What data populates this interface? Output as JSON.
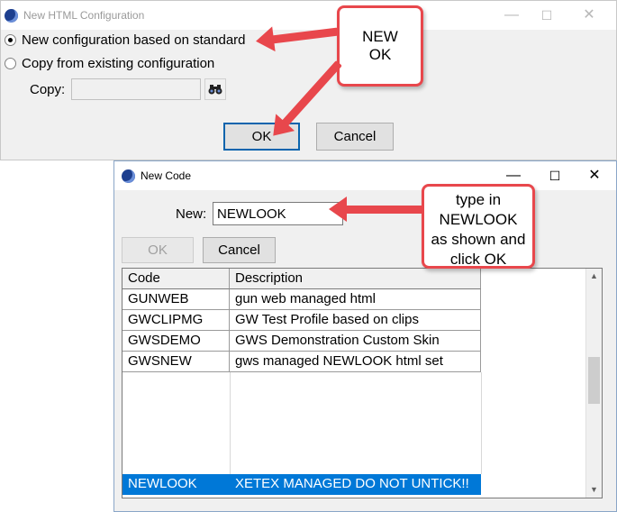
{
  "dialog1": {
    "title": "New HTML Configuration",
    "controls": {
      "minimize": "—",
      "maximize": "☐",
      "close": "✕"
    },
    "option_standard": "New configuration based on standard",
    "option_copy": "Copy from existing configuration",
    "copy_label": "Copy:",
    "copy_value": "",
    "ok_label": "OK",
    "cancel_label": "Cancel"
  },
  "dialog2": {
    "title": "New Code",
    "controls": {
      "minimize": "—",
      "maximize": "☐",
      "close": "✕"
    },
    "new_label": "New:",
    "new_value": "NEWLOOK",
    "ok_label": "OK",
    "cancel_label": "Cancel",
    "columns": [
      "Code",
      "Description"
    ],
    "rows": [
      {
        "code": "GUNWEB",
        "description": "gun web managed html"
      },
      {
        "code": "GWCLIPMG",
        "description": "GW Test Profile based on clips"
      },
      {
        "code": "GWSDEMO",
        "description": "GWS Demonstration Custom Skin"
      },
      {
        "code": "GWSNEW",
        "description": "gws managed NEWLOOK html set"
      }
    ],
    "selected_row": {
      "code": "NEWLOOK",
      "description": "XETEX MANAGED DO NOT UNTICK!!"
    },
    "scroll_up": "▲",
    "scroll_down": "▼"
  },
  "annotations": {
    "callout1_line1": "NEW",
    "callout1_line2": "OK",
    "callout2_line1": "type in",
    "callout2_line2": "NEWLOOK",
    "callout2_line3": "as shown and",
    "callout2_line4": "click OK"
  },
  "colors": {
    "selection": "#0078d7",
    "annotation_red": "#e8474c",
    "default_button_border": "#0a64ad",
    "dialog_bg": "#f0f0f0"
  },
  "icons": {
    "app": "globe-logo-icon",
    "browse": "binoculars-icon"
  }
}
